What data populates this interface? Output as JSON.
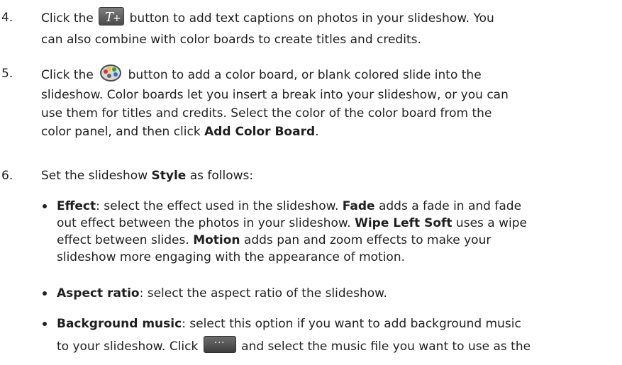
{
  "step4": {
    "number": "4.",
    "line1_before": "Click the ",
    "line1_after": " button to add text captions on photos in your slideshow. You",
    "line2": "can also combine with color boards to create titles and credits.",
    "icon": "text-caption-icon"
  },
  "step5": {
    "number": "5.",
    "line1_before": "Click the ",
    "line1_after": " button to add a color board, or blank colored slide into the",
    "line2": "slideshow. Color boards let you insert a break into your slideshow, or you can",
    "line3": "use them for titles and credits. Select the color of the color board from the",
    "line4_before": "color panel, and then click ",
    "line4_bold": "Add Color Board",
    "line4_after": ".",
    "icon": "color-board-palette-icon"
  },
  "step6": {
    "number": "6.",
    "before": "Set the slideshow ",
    "bold": "Style",
    "after": " as follows:"
  },
  "bullets": {
    "effect": {
      "label": "Effect",
      "l1a": ": select the effect used in the slideshow. ",
      "l1b": "Fade",
      "l1c": " adds a fade in and fade",
      "l2a": "out effect between the photos in your slideshow. ",
      "l2b": "Wipe Left Soft",
      "l2c": " uses a wipe",
      "l3a": "effect between slides. ",
      "l3b": "Motion",
      "l3c": " adds pan and zoom effects to make your",
      "l4": "slideshow more engaging with the appearance of motion."
    },
    "aspect": {
      "label": "Aspect ratio",
      "text": ": select the aspect ratio of the slideshow."
    },
    "music": {
      "label": "Background music",
      "l1": ": select this option if you want to add background music",
      "l2a": "to your slideshow. Click ",
      "l2b": " and select the music file you want to use as the",
      "browse_label": "···"
    }
  }
}
